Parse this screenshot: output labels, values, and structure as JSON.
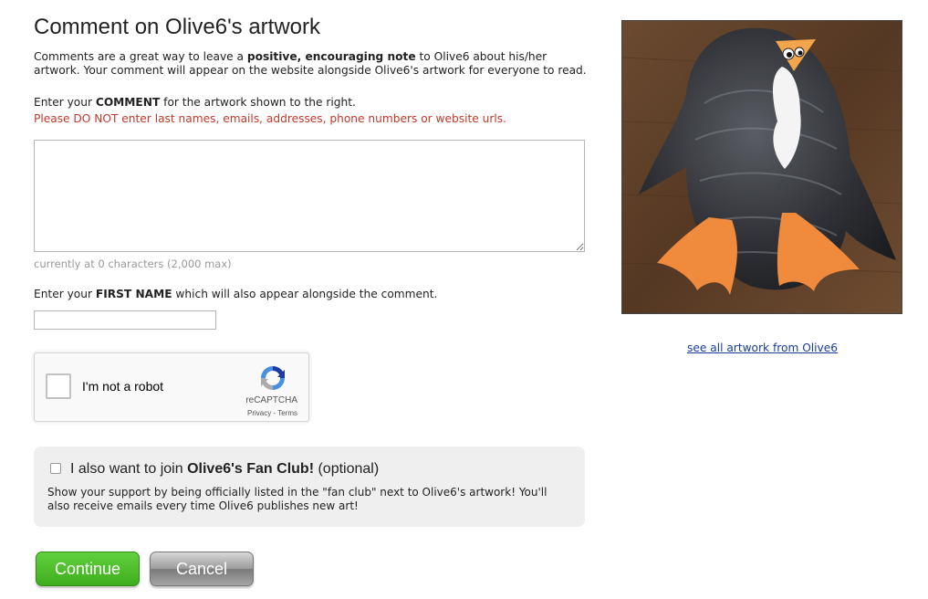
{
  "page": {
    "title": "Comment on Olive6's artwork"
  },
  "intro": {
    "text_before": "Comments are a great way to leave a ",
    "bold": "positive, encouraging note",
    "text_after": " to Olive6 about his/her artwork. Your comment will appear on the website alongside Olive6's artwork for everyone to read."
  },
  "comment": {
    "prompt_before": "Enter your ",
    "prompt_bold": "COMMENT",
    "prompt_after": " for the artwork shown to the right.",
    "warning": "Please DO NOT enter last names, emails, addresses, phone numbers or website urls.",
    "value": "",
    "counter": "currently at 0 characters (2,000 max)"
  },
  "first_name": {
    "prompt_before": "Enter your ",
    "prompt_bold": "FIRST NAME",
    "prompt_after": " which will also appear alongside the comment.",
    "value": ""
  },
  "recaptcha": {
    "label": "I'm not a robot",
    "brand": "reCAPTCHA",
    "terms": "Privacy - Terms",
    "checked": false
  },
  "fan_club": {
    "checked": false,
    "text_before": "I also want to join ",
    "bold": "Olive6's Fan Club!",
    "text_after": " (optional)",
    "description": "Show your support by being officially listed in the \"fan club\" next to Olive6's artwork! You'll also receive emails every time Olive6 publishes new art!"
  },
  "buttons": {
    "continue": "Continue",
    "cancel": "Cancel"
  },
  "artwork": {
    "link": "see all artwork from Olive6"
  },
  "colors": {
    "warning": "#c0392b",
    "continue_button": "#3eae1e",
    "link": "#1a3c9c"
  }
}
